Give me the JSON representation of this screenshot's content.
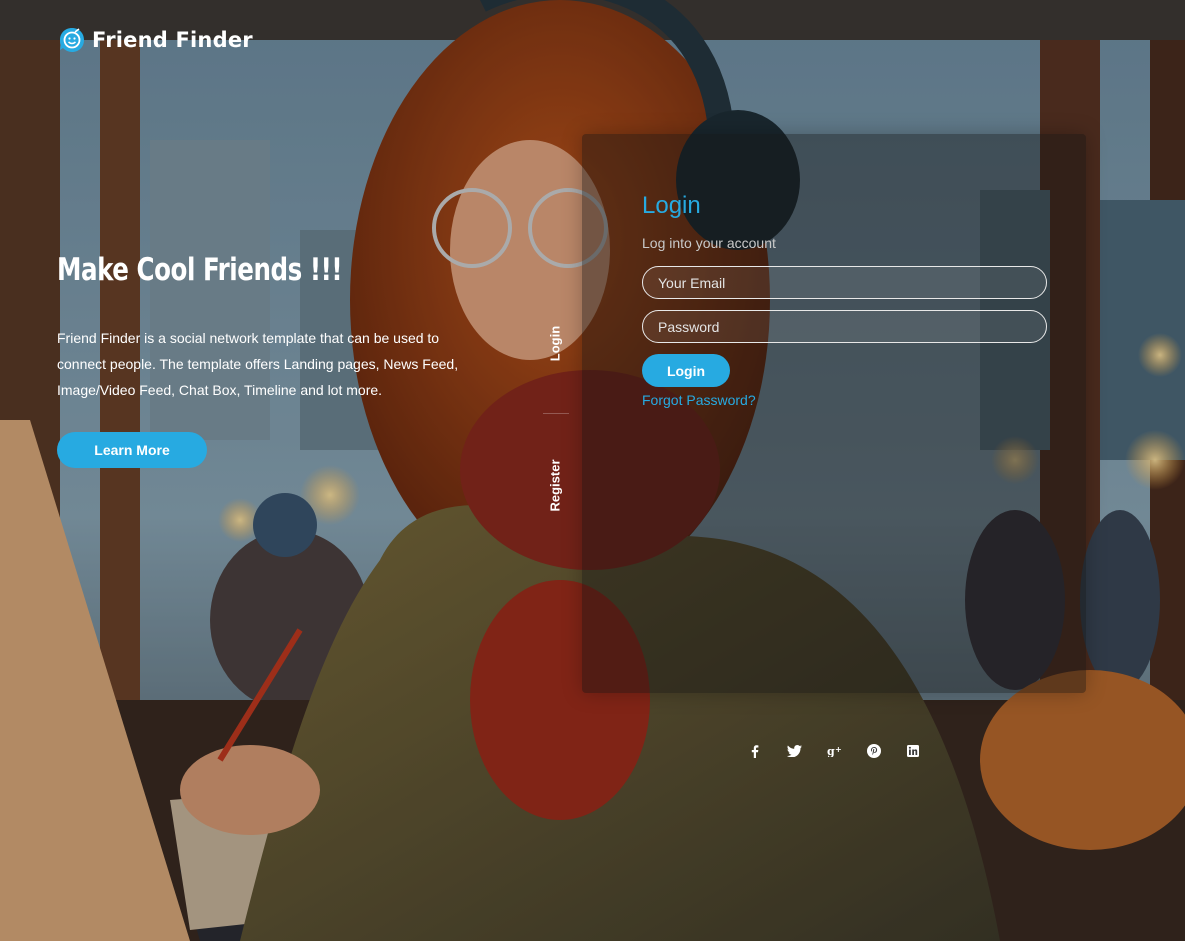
{
  "brand": {
    "name": "Friend Finder",
    "accent_color": "#27aae1",
    "icon": "smiley-logo-icon"
  },
  "hero": {
    "title": "Make Cool Friends !!!",
    "description": "Friend Finder is a social network template that can be used to connect people. The template offers Landing pages, News Feed, Image/Video Feed, Chat Box, Timeline and lot more.",
    "cta_label": "Learn More"
  },
  "tabs": {
    "login_label": "Login",
    "register_label": "Register"
  },
  "login_form": {
    "title": "Login",
    "subtitle": "Log into your account",
    "email_placeholder": "Your Email",
    "email_value": "",
    "password_placeholder": "Password",
    "password_value": "",
    "submit_label": "Login",
    "forgot_label": "Forgot Password?"
  },
  "social": [
    {
      "name": "facebook",
      "icon": "facebook-icon"
    },
    {
      "name": "twitter",
      "icon": "twitter-icon"
    },
    {
      "name": "google-plus",
      "icon": "google-plus-icon"
    },
    {
      "name": "pinterest",
      "icon": "pinterest-icon"
    },
    {
      "name": "linkedin",
      "icon": "linkedin-icon"
    }
  ]
}
